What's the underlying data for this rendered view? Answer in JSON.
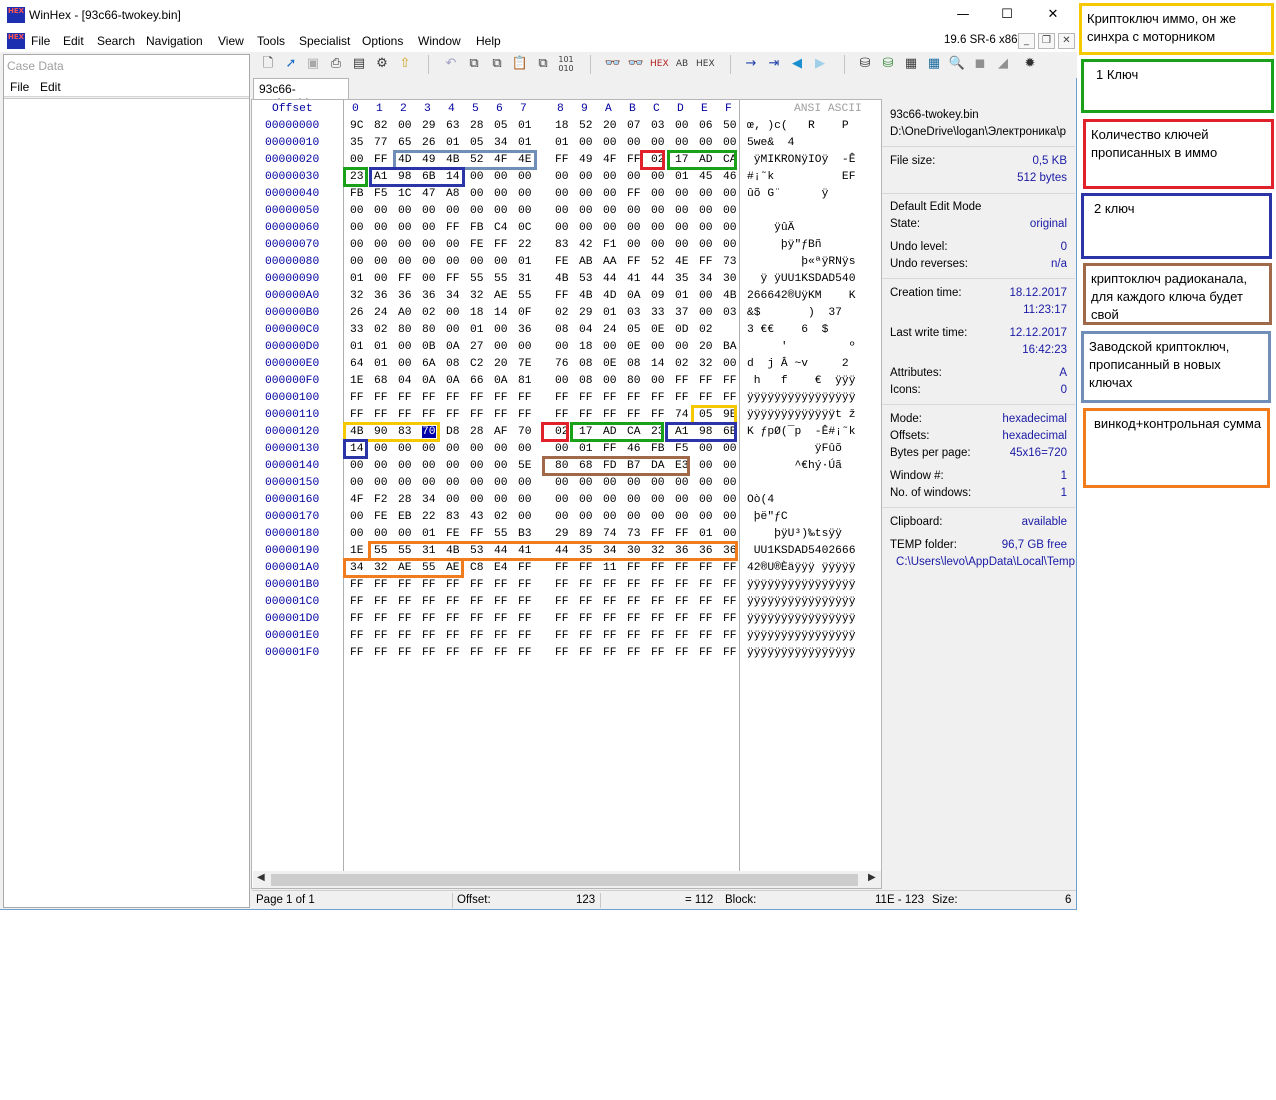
{
  "window": {
    "title": "WinHex - [93c66-twokey.bin]",
    "minimize": "—",
    "maximize": "☐",
    "close": "✕",
    "app_icon_text": "HEX"
  },
  "menu": {
    "items": [
      "File",
      "Edit",
      "Search",
      "Navigation",
      "View",
      "Tools",
      "Specialist",
      "Options",
      "Window",
      "Help"
    ],
    "version": "19.6 SR-6 x86",
    "mdi_min": "_",
    "mdi_restore": "❐",
    "mdi_close": "✕"
  },
  "case_pane": {
    "title": "Case Data",
    "menu": [
      "File",
      "Edit"
    ]
  },
  "tab": {
    "label": "93c66-twokey.bin"
  },
  "editor": {
    "offset_header": "Offset",
    "column_headers": [
      "0",
      "1",
      "2",
      "3",
      "4",
      "5",
      "6",
      "7",
      "8",
      "9",
      "A",
      "B",
      "C",
      "D",
      "E",
      "F"
    ],
    "ascii_header": "ANSI ASCII",
    "rows": [
      {
        "offset": "00000000",
        "hex": [
          "9C",
          "82",
          "00",
          "29",
          "63",
          "28",
          "05",
          "01",
          "18",
          "52",
          "20",
          "07",
          "03",
          "00",
          "06",
          "50"
        ],
        "ascii": "œ‚ )c(   R    P"
      },
      {
        "offset": "00000010",
        "hex": [
          "35",
          "77",
          "65",
          "26",
          "01",
          "05",
          "34",
          "01",
          "01",
          "00",
          "00",
          "00",
          "00",
          "00",
          "00",
          "00"
        ],
        "ascii": "5we&  4"
      },
      {
        "offset": "00000020",
        "hex": [
          "00",
          "FF",
          "4D",
          "49",
          "4B",
          "52",
          "4F",
          "4E",
          "FF",
          "49",
          "4F",
          "FF",
          "02",
          "17",
          "AD",
          "CA"
        ],
        "ascii": " ÿMIKRONÿIOÿ  -Ê"
      },
      {
        "offset": "00000030",
        "hex": [
          "23",
          "A1",
          "98",
          "6B",
          "14",
          "00",
          "00",
          "00",
          "00",
          "00",
          "00",
          "00",
          "00",
          "01",
          "45",
          "46"
        ],
        "ascii": "#¡˜k          EF"
      },
      {
        "offset": "00000040",
        "hex": [
          "FB",
          "F5",
          "1C",
          "47",
          "A8",
          "00",
          "00",
          "00",
          "00",
          "00",
          "00",
          "FF",
          "00",
          "00",
          "00",
          "00"
        ],
        "ascii": "ûõ G¨      ÿ"
      },
      {
        "offset": "00000050",
        "hex": [
          "00",
          "00",
          "00",
          "00",
          "00",
          "00",
          "00",
          "00",
          "00",
          "00",
          "00",
          "00",
          "00",
          "00",
          "00",
          "00"
        ],
        "ascii": ""
      },
      {
        "offset": "00000060",
        "hex": [
          "00",
          "00",
          "00",
          "00",
          "FF",
          "FB",
          "C4",
          "0C",
          "00",
          "00",
          "00",
          "00",
          "00",
          "00",
          "00",
          "00"
        ],
        "ascii": "    ÿûÄ"
      },
      {
        "offset": "00000070",
        "hex": [
          "00",
          "00",
          "00",
          "00",
          "00",
          "FE",
          "FF",
          "22",
          "83",
          "42",
          "F1",
          "00",
          "00",
          "00",
          "00",
          "00"
        ],
        "ascii": "     þÿ\"ƒBñ"
      },
      {
        "offset": "00000080",
        "hex": [
          "00",
          "00",
          "00",
          "00",
          "00",
          "00",
          "00",
          "01",
          "FE",
          "AB",
          "AA",
          "FF",
          "52",
          "4E",
          "FF",
          "73"
        ],
        "ascii": "        þ«ªÿRNÿs"
      },
      {
        "offset": "00000090",
        "hex": [
          "01",
          "00",
          "FF",
          "00",
          "FF",
          "55",
          "55",
          "31",
          "4B",
          "53",
          "44",
          "41",
          "44",
          "35",
          "34",
          "30"
        ],
        "ascii": "  ÿ ÿUU1KSDAD540"
      },
      {
        "offset": "000000A0",
        "hex": [
          "32",
          "36",
          "36",
          "36",
          "34",
          "32",
          "AE",
          "55",
          "FF",
          "4B",
          "4D",
          "0A",
          "09",
          "01",
          "00",
          "4B"
        ],
        "ascii": "266642®UÿKM    K"
      },
      {
        "offset": "000000B0",
        "hex": [
          "26",
          "24",
          "A0",
          "02",
          "00",
          "18",
          "14",
          "0F",
          "02",
          "29",
          "01",
          "03",
          "33",
          "37",
          "00",
          "03"
        ],
        "ascii": "&$       )  37"
      },
      {
        "offset": "000000C0",
        "hex": [
          "33",
          "02",
          "80",
          "80",
          "00",
          "01",
          "00",
          "36",
          "08",
          "04",
          "24",
          "05",
          "0E",
          "0D",
          "02"
        ],
        "ascii": "3 €€    6  $"
      },
      {
        "offset": "000000D0",
        "hex": [
          "01",
          "01",
          "00",
          "0B",
          "0A",
          "27",
          "00",
          "00",
          "00",
          "18",
          "00",
          "0E",
          "00",
          "00",
          "20",
          "BA"
        ],
        "ascii": "     '         º"
      },
      {
        "offset": "000000E0",
        "hex": [
          "64",
          "01",
          "00",
          "6A",
          "08",
          "C2",
          "20",
          "7E",
          "76",
          "08",
          "0E",
          "08",
          "14",
          "02",
          "32",
          "00"
        ],
        "ascii": "d  j Â ~v     2"
      },
      {
        "offset": "000000F0",
        "hex": [
          "1E",
          "68",
          "04",
          "0A",
          "0A",
          "66",
          "0A",
          "81",
          "00",
          "08",
          "00",
          "80",
          "00",
          "FF",
          "FF",
          "FF"
        ],
        "ascii": " h   f    €  ÿÿÿ"
      },
      {
        "offset": "00000100",
        "hex": [
          "FF",
          "FF",
          "FF",
          "FF",
          "FF",
          "FF",
          "FF",
          "FF",
          "FF",
          "FF",
          "FF",
          "FF",
          "FF",
          "FF",
          "FF",
          "FF"
        ],
        "ascii": "ÿÿÿÿÿÿÿÿÿÿÿÿÿÿÿÿ"
      },
      {
        "offset": "00000110",
        "hex": [
          "FF",
          "FF",
          "FF",
          "FF",
          "FF",
          "FF",
          "FF",
          "FF",
          "FF",
          "FF",
          "FF",
          "FF",
          "FF",
          "74",
          "05",
          "9E"
        ],
        "ascii": "ÿÿÿÿÿÿÿÿÿÿÿÿÿt ž"
      },
      {
        "offset": "00000120",
        "hex": [
          "4B",
          "90",
          "83",
          "70",
          "D8",
          "28",
          "AF",
          "70",
          "02",
          "17",
          "AD",
          "CA",
          "23",
          "A1",
          "98",
          "6B"
        ],
        "ascii": "K ƒpØ(¯p  -Ê#¡˜k"
      },
      {
        "offset": "00000130",
        "hex": [
          "14",
          "00",
          "00",
          "00",
          "00",
          "00",
          "00",
          "00",
          "00",
          "01",
          "FF",
          "46",
          "FB",
          "F5",
          "00",
          "00"
        ],
        "ascii": "          ÿFûõ"
      },
      {
        "offset": "00000140",
        "hex": [
          "00",
          "00",
          "00",
          "00",
          "00",
          "00",
          "00",
          "5E",
          "80",
          "68",
          "FD",
          "B7",
          "DA",
          "E3",
          "00",
          "00"
        ],
        "ascii": "       ^€hý·Úã"
      },
      {
        "offset": "00000150",
        "hex": [
          "00",
          "00",
          "00",
          "00",
          "00",
          "00",
          "00",
          "00",
          "00",
          "00",
          "00",
          "00",
          "00",
          "00",
          "00",
          "00"
        ],
        "ascii": ""
      },
      {
        "offset": "00000160",
        "hex": [
          "4F",
          "F2",
          "28",
          "34",
          "00",
          "00",
          "00",
          "00",
          "00",
          "00",
          "00",
          "00",
          "00",
          "00",
          "00",
          "00"
        ],
        "ascii": "Oò(4"
      },
      {
        "offset": "00000170",
        "hex": [
          "00",
          "FE",
          "EB",
          "22",
          "83",
          "43",
          "02",
          "00",
          "00",
          "00",
          "00",
          "00",
          "00",
          "00",
          "00",
          "00"
        ],
        "ascii": " þë\"ƒC"
      },
      {
        "offset": "00000180",
        "hex": [
          "00",
          "00",
          "00",
          "01",
          "FE",
          "FF",
          "55",
          "B3",
          "29",
          "89",
          "74",
          "73",
          "FF",
          "FF",
          "01",
          "00"
        ],
        "ascii": "    þÿU³)‰tsÿÿ"
      },
      {
        "offset": "00000190",
        "hex": [
          "1E",
          "55",
          "55",
          "31",
          "4B",
          "53",
          "44",
          "41",
          "44",
          "35",
          "34",
          "30",
          "32",
          "36",
          "36",
          "36"
        ],
        "ascii": " UU1KSDAD5402666"
      },
      {
        "offset": "000001A0",
        "hex": [
          "34",
          "32",
          "AE",
          "55",
          "AE",
          "C8",
          "E4",
          "FF",
          "FF",
          "FF",
          "11",
          "FF",
          "FF",
          "FF",
          "FF",
          "FF"
        ],
        "ascii": "42®U®Èäÿÿÿ ÿÿÿÿÿ"
      },
      {
        "offset": "000001B0",
        "hex": [
          "FF",
          "FF",
          "FF",
          "FF",
          "FF",
          "FF",
          "FF",
          "FF",
          "FF",
          "FF",
          "FF",
          "FF",
          "FF",
          "FF",
          "FF",
          "FF"
        ],
        "ascii": "ÿÿÿÿÿÿÿÿÿÿÿÿÿÿÿÿ"
      },
      {
        "offset": "000001C0",
        "hex": [
          "FF",
          "FF",
          "FF",
          "FF",
          "FF",
          "FF",
          "FF",
          "FF",
          "FF",
          "FF",
          "FF",
          "FF",
          "FF",
          "FF",
          "FF",
          "FF"
        ],
        "ascii": "ÿÿÿÿÿÿÿÿÿÿÿÿÿÿÿÿ"
      },
      {
        "offset": "000001D0",
        "hex": [
          "FF",
          "FF",
          "FF",
          "FF",
          "FF",
          "FF",
          "FF",
          "FF",
          "FF",
          "FF",
          "FF",
          "FF",
          "FF",
          "FF",
          "FF",
          "FF"
        ],
        "ascii": "ÿÿÿÿÿÿÿÿÿÿÿÿÿÿÿÿ"
      },
      {
        "offset": "000001E0",
        "hex": [
          "FF",
          "FF",
          "FF",
          "FF",
          "FF",
          "FF",
          "FF",
          "FF",
          "FF",
          "FF",
          "FF",
          "FF",
          "FF",
          "FF",
          "FF",
          "FF"
        ],
        "ascii": "ÿÿÿÿÿÿÿÿÿÿÿÿÿÿÿÿ"
      },
      {
        "offset": "000001F0",
        "hex": [
          "FF",
          "FF",
          "FF",
          "FF",
          "FF",
          "FF",
          "FF",
          "FF",
          "FF",
          "FF",
          "FF",
          "FF",
          "FF",
          "FF",
          "FF",
          "FF"
        ],
        "ascii": "ÿÿÿÿÿÿÿÿÿÿÿÿÿÿÿÿ"
      }
    ]
  },
  "info": {
    "file_name": "93c66-twokey.bin",
    "path": "D:\\OneDrive\\logan\\Электроника\\p",
    "file_size_label": "File size:",
    "file_size": "0,5 KB",
    "file_size_bytes": "512 bytes",
    "edit_mode": "Default Edit Mode",
    "state_label": "State:",
    "state": "original",
    "undo_level_label": "Undo level:",
    "undo_level": "0",
    "undo_reverses_label": "Undo reverses:",
    "undo_reverses": "n/a",
    "creation_label": "Creation time:",
    "creation_date": "18.12.2017",
    "creation_time": "11:23:17",
    "write_label": "Last write time:",
    "write_date": "12.12.2017",
    "write_time": "16:42:23",
    "attributes_label": "Attributes:",
    "attributes": "A",
    "icons_label": "Icons:",
    "icons": "0",
    "mode_label": "Mode:",
    "mode": "hexadecimal",
    "offsets_label": "Offsets:",
    "offsets": "hexadecimal",
    "bpp_label": "Bytes per page:",
    "bpp": "45x16=720",
    "window_no_label": "Window #:",
    "window_no": "1",
    "windows_label": "No. of windows:",
    "windows": "1",
    "clipboard_label": "Clipboard:",
    "clipboard": "available",
    "temp_label": "TEMP folder:",
    "temp_free": "96,7 GB free",
    "temp_path": "C:\\Users\\levo\\AppData\\Local\\Temp"
  },
  "status": {
    "page": "Page 1 of 1",
    "offset_label": "Offset:",
    "offset_value": "123",
    "offset_dec": "= 112",
    "block_label": "Block:",
    "block_value": "11E - 123",
    "size_label": "Size:",
    "size_value": "6"
  },
  "legend": [
    {
      "text": "Криптоключ иммо, он же синхра с моторником",
      "color": "#f5c800"
    },
    {
      "text": "1 Ключ",
      "color": "#1aa11a"
    },
    {
      "text": "Количество ключей прописанных в иммо",
      "color": "#e0202a"
    },
    {
      "text": "2 ключ",
      "color": "#2b35a8"
    },
    {
      "text": "криптоключ радиоканала, для каждого ключа будет свой",
      "color": "#a0694a"
    },
    {
      "text": "Заводской криптоключ, прописанный в новых ключах",
      "color": "#6f8fb8"
    },
    {
      "text": "винкод+контрольная сумма",
      "color": "#f07c1e"
    }
  ]
}
